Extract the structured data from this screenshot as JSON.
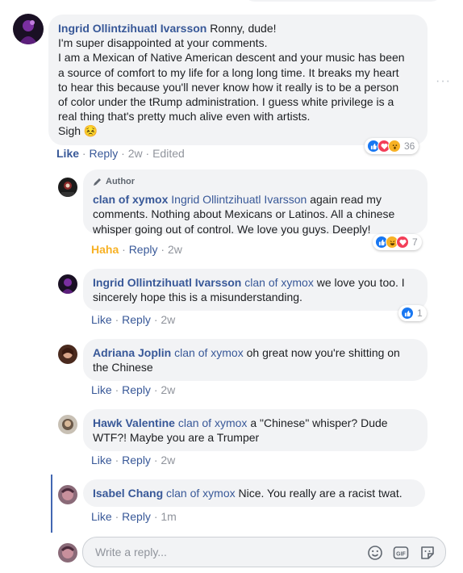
{
  "comments": [
    {
      "name": "Ingrid Ollintzihuatl Ivarsson",
      "lines": [
        "Ronny, dude!",
        "I'm super disappointed at your comments.",
        "I am a Mexican of Native American descent and your music has been",
        "a source of comfort to my life for a long long time. It breaks my heart",
        "to hear this because you'll never know how it really is to be a person",
        "of color under the tRump administration. I guess white privilege is a",
        "real thing that's pretty much alive even with artists.",
        "Sigh 😣"
      ],
      "actions": {
        "like": "Like",
        "reply": "Reply",
        "time": "2w",
        "edited": "Edited"
      },
      "reaction_count": "36"
    },
    {
      "author_tag": "Author",
      "name": "clan of xymox",
      "mention": "Ingrid Ollintzihuatl Ivarsson",
      "text_first": "again read my",
      "lines": [
        "comments. Nothing about Mexicans or Latinos. All a chinese",
        "whisper going out of control. We love you guys. Deeply!"
      ],
      "actions": {
        "like": "Haha",
        "reply": "Reply",
        "time": "2w"
      },
      "reaction_count": "7"
    },
    {
      "name": "Ingrid Ollintzihuatl Ivarsson",
      "mention": "clan of xymox",
      "text_first": "we love you too. I",
      "lines": [
        "sincerely hope this is a misunderstanding."
      ],
      "actions": {
        "like": "Like",
        "reply": "Reply",
        "time": "2w"
      },
      "reaction_count": "1"
    },
    {
      "name": "Adriana Joplin",
      "mention": "clan of xymox",
      "text_first": "oh great now you're shitting on",
      "lines": [
        "the Chinese"
      ],
      "actions": {
        "like": "Like",
        "reply": "Reply",
        "time": "2w"
      }
    },
    {
      "name": "Hawk Valentine",
      "mention": "clan of xymox",
      "text_first": "a \"Chinese\" whisper? Dude",
      "lines": [
        "WTF?! Maybe you are a Trumper"
      ],
      "actions": {
        "like": "Like",
        "reply": "Reply",
        "time": "2w"
      }
    },
    {
      "name": "Isabel Chang",
      "mention": "clan of xymox",
      "text_first": "Nice. You really are a racist twat.",
      "lines": [],
      "actions": {
        "like": "Like",
        "reply": "Reply",
        "time": "1m"
      }
    }
  ],
  "separator": "·",
  "reply_box": {
    "placeholder": "Write a reply..."
  },
  "icons": {
    "reactions": [
      "like-reaction-icon",
      "love-reaction-icon",
      "wow-reaction-icon",
      "haha-reaction-icon"
    ],
    "reply_box": [
      "emoji-icon",
      "gif-icon",
      "sticker-icon"
    ],
    "author_badge": "pencil-icon"
  },
  "colors": {
    "link": "#385898",
    "bubble": "#f2f3f5",
    "meta": "#90949c",
    "haha": "#f7b125",
    "thread_line": "#4267b2"
  }
}
